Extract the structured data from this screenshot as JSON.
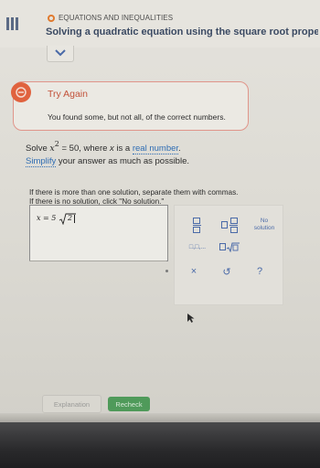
{
  "header": {
    "topic": "EQUATIONS AND INEQUALITIES",
    "title": "Solving a quadratic equation using the square root property:..."
  },
  "feedback": {
    "title": "Try Again",
    "message": "You found some, but not all, of the correct numbers."
  },
  "problem": {
    "prefix": "Solve ",
    "base": "x",
    "exponent": "2",
    "equation_rest": " = 50, where ",
    "variable": "x",
    "is_a": " is a ",
    "link_real": "real number",
    "period": ".",
    "link_simplify": "Simplify",
    "line2_rest": " your answer as much as possible."
  },
  "instructions": {
    "line1": "If there is more than one solution, separate them with commas.",
    "line2": "If there is no solution, click \"No solution.\""
  },
  "answer": {
    "lhs": "x = 5",
    "radicand": "2"
  },
  "keypad": {
    "no_solution": "No solution",
    "comma": "□,□,...",
    "clear": "×",
    "undo": "↺",
    "help": "?"
  },
  "buttons": {
    "explanation": "Explanation",
    "recheck": "Recheck"
  },
  "colors": {
    "accent": "#e07a2e",
    "error": "#e0623e",
    "link": "#2f6db3",
    "recheck": "#4f9a5a"
  }
}
